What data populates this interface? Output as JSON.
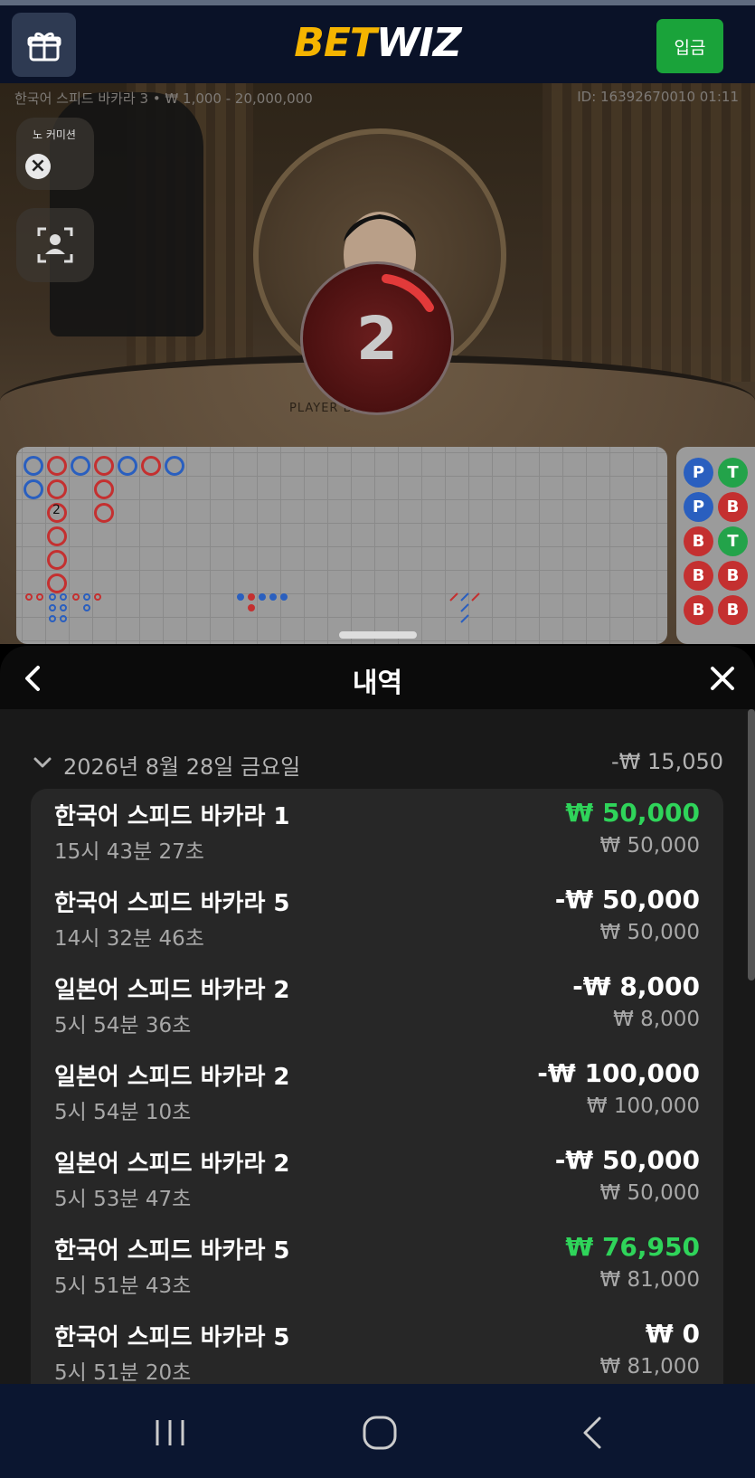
{
  "header": {
    "logo_bet": "BET",
    "logo_wiz": "WIZ",
    "deposit_label": "입금",
    "gift_icon": "gift-icon"
  },
  "game": {
    "table_info": "한국어 스피드 바카라 3 • ₩ 1,000 - 20,000,000",
    "round_id": "ID: 16392670010 01:11",
    "no_commission_label": "노 커미션",
    "countdown": "2",
    "table_text": "PLAYER    BANKER",
    "road_number": "2"
  },
  "bead_road": [
    {
      "label": "P",
      "color": "#2a5fbf"
    },
    {
      "label": "T",
      "color": "#23a34a"
    },
    {
      "label": "P",
      "color": "#2a5fbf"
    },
    {
      "label": "B",
      "color": "#c43030"
    },
    {
      "label": "B",
      "color": "#c43030"
    },
    {
      "label": "T",
      "color": "#23a34a"
    },
    {
      "label": "B",
      "color": "#c43030"
    },
    {
      "label": "B",
      "color": "#c43030"
    },
    {
      "label": "B",
      "color": "#c43030"
    },
    {
      "label": "B",
      "color": "#c43030"
    }
  ],
  "history": {
    "title": "내역",
    "date": "2026년 8월 28일 금요일",
    "date_total": "-₩ 15,050",
    "rows": [
      {
        "name": "한국어 스피드 바카라 1",
        "time": "15시 43분 27초",
        "result": "₩ 50,000",
        "stake": "₩ 50,000",
        "win": true
      },
      {
        "name": "한국어 스피드 바카라 5",
        "time": "14시 32분 46초",
        "result": "-₩ 50,000",
        "stake": "₩ 50,000",
        "win": false
      },
      {
        "name": "일본어 스피드 바카라 2",
        "time": "5시 54분 36초",
        "result": "-₩ 8,000",
        "stake": "₩ 8,000",
        "win": false
      },
      {
        "name": "일본어 스피드 바카라 2",
        "time": "5시 54분 10초",
        "result": "-₩ 100,000",
        "stake": "₩ 100,000",
        "win": false
      },
      {
        "name": "일본어 스피드 바카라 2",
        "time": "5시 53분 47초",
        "result": "-₩ 50,000",
        "stake": "₩ 50,000",
        "win": false
      },
      {
        "name": "한국어 스피드 바카라 5",
        "time": "5시 51분 43초",
        "result": "₩ 76,950",
        "stake": "₩ 81,000",
        "win": true
      },
      {
        "name": "한국어 스피드 바카라 5",
        "time": "5시 51분 20초",
        "result": "₩ 0",
        "stake": "₩ 81,000",
        "win": false
      }
    ]
  },
  "colors": {
    "brand_yellow": "#f5b400",
    "deposit_green": "#1aa33a",
    "win_green": "#2fd45a",
    "player_blue": "#2a5fbf",
    "banker_red": "#c43030"
  }
}
